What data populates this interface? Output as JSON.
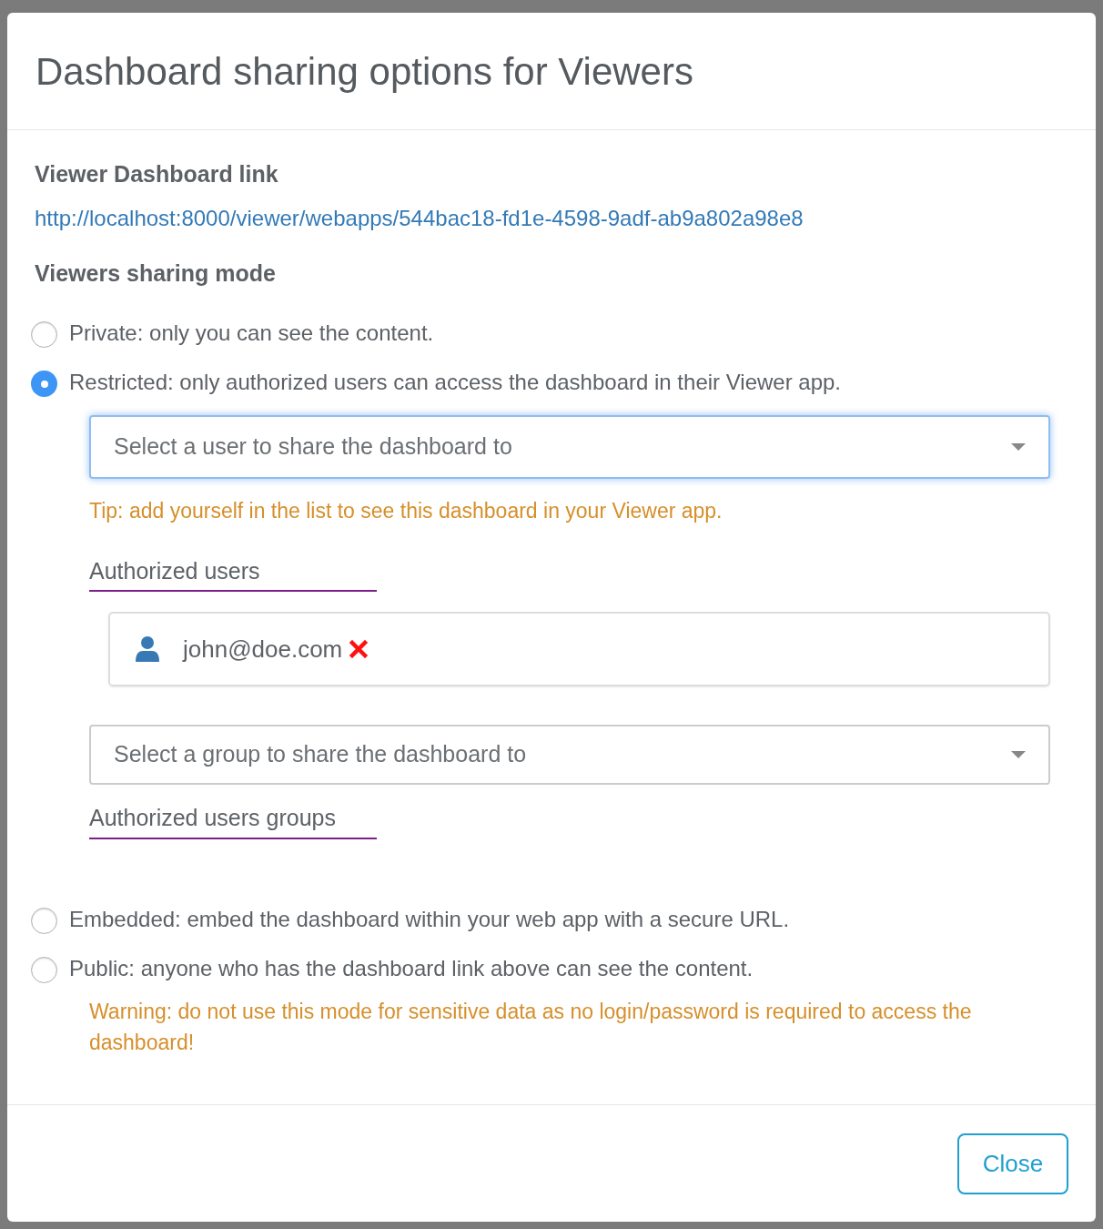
{
  "dialog": {
    "title": "Dashboard sharing options for Viewers"
  },
  "link_section": {
    "heading": "Viewer Dashboard link",
    "url": "http://localhost:8000/viewer/webapps/544bac18-fd1e-4598-9adf-ab9a802a98e8"
  },
  "mode_heading": "Viewers sharing mode",
  "modes": [
    {
      "label": "Private: only you can see the content.",
      "selected": false
    },
    {
      "label": "Restricted: only authorized users can access the dashboard in their Viewer app.",
      "selected": true,
      "details": {
        "user_select": {
          "placeholder": "Select a user to share the dashboard to",
          "focused": true
        },
        "tip": "Tip: add yourself in the list to see this dashboard in your Viewer app.",
        "users_heading": "Authorized users",
        "users": [
          "john@doe.com"
        ],
        "group_select": {
          "placeholder": "Select a group to share the dashboard to",
          "focused": false
        },
        "groups_heading": "Authorized users groups"
      }
    },
    {
      "label": "Embedded: embed the dashboard within your web app with a secure URL.",
      "selected": false
    },
    {
      "label": "Public: anyone who has the dashboard link above can see the content.",
      "selected": false,
      "warning": "Warning: do not use this mode for sensitive data as no login/password is required to access the dashboard!"
    }
  ],
  "footer": {
    "close_button": "Close"
  }
}
